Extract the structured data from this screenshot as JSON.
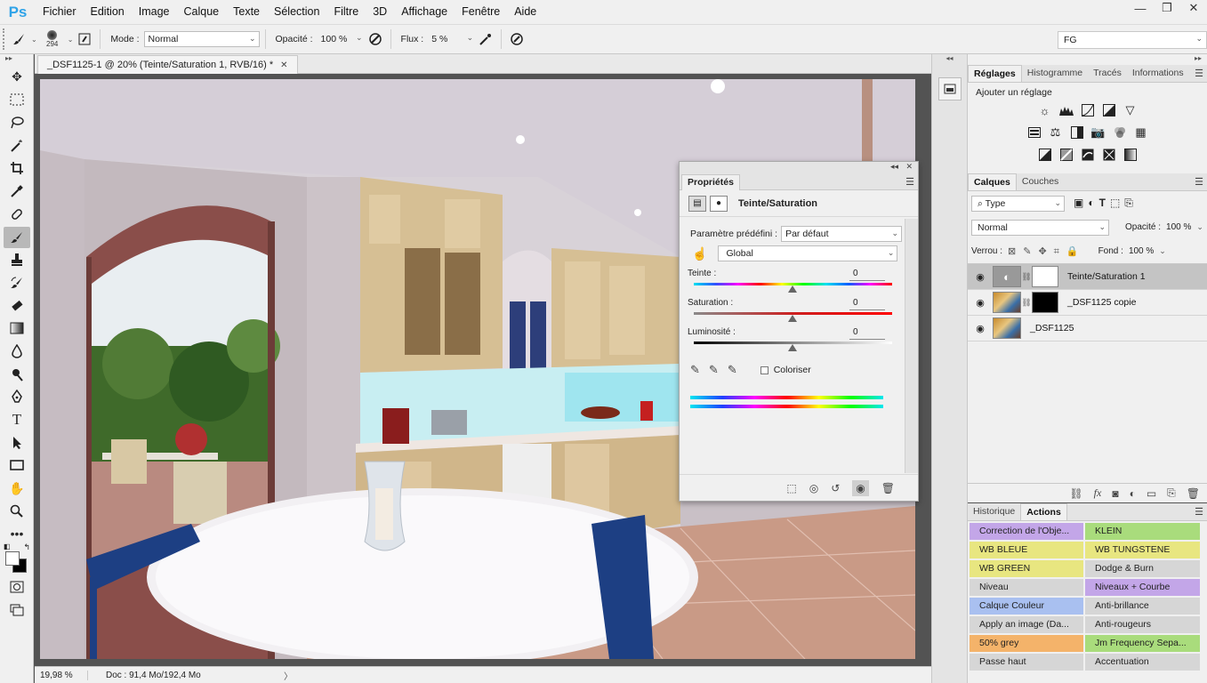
{
  "app": {
    "logo": "Ps"
  },
  "menu": [
    "Fichier",
    "Edition",
    "Image",
    "Calque",
    "Texte",
    "Sélection",
    "Filtre",
    "3D",
    "Affichage",
    "Fenêtre",
    "Aide"
  ],
  "window_controls": {
    "minimize": "—",
    "restore": "❐",
    "close": "✕"
  },
  "options": {
    "brush_size": "294",
    "mode_label": "Mode :",
    "mode_value": "Normal",
    "opacity_label": "Opacité :",
    "opacity_value": "100 %",
    "flow_label": "Flux :",
    "flow_value": "5 %",
    "workspace": "FG"
  },
  "document": {
    "tab_title": "_DSF1125-1 @ 20% (Teinte/Saturation 1, RVB/16) *",
    "zoom": "19,98 %",
    "doc_info": "Doc : 91,4 Mo/192,4 Mo"
  },
  "tools": [
    "move-tool",
    "marquee-tool",
    "lasso-tool",
    "magic-wand-tool",
    "crop-tool",
    "eyedropper-tool",
    "healing-brush-tool",
    "brush-tool",
    "clone-stamp-tool",
    "history-brush-tool",
    "eraser-tool",
    "gradient-tool",
    "blur-tool",
    "dodge-tool",
    "pen-tool",
    "type-tool",
    "path-selection-tool",
    "rectangle-tool",
    "hand-tool",
    "zoom-tool",
    "more-tools"
  ],
  "adjustments_panel": {
    "tabs": [
      "Réglages",
      "Histogramme",
      "Tracés",
      "Informations"
    ],
    "title": "Ajouter un réglage"
  },
  "layers_panel": {
    "tabs": [
      "Calques",
      "Couches"
    ],
    "filter": "Type",
    "blend_mode": "Normal",
    "opacity_label": "Opacité :",
    "opacity_value": "100 %",
    "lock_label": "Verrou :",
    "fill_label": "Fond :",
    "fill_value": "100 %",
    "layers": [
      {
        "name": "Teinte/Saturation 1"
      },
      {
        "name": "_DSF1125 copie"
      },
      {
        "name": "_DSF1125"
      }
    ]
  },
  "actions_panel": {
    "tabs": [
      "Historique",
      "Actions"
    ],
    "items": [
      {
        "label": "Correction de l'Obje...",
        "color": "#c3a6e8"
      },
      {
        "label": "KLEIN",
        "color": "#a9dc7c"
      },
      {
        "label": "WB BLEUE",
        "color": "#e8e680"
      },
      {
        "label": "WB TUNGSTENE",
        "color": "#e8e680"
      },
      {
        "label": "WB GREEN",
        "color": "#e8e680"
      },
      {
        "label": "Dodge & Burn",
        "color": "#d6d6d6"
      },
      {
        "label": "Niveau",
        "color": "#d6d6d6"
      },
      {
        "label": "Niveaux + Courbe",
        "color": "#c3a6e8"
      },
      {
        "label": "Calque Couleur",
        "color": "#a9c0f0"
      },
      {
        "label": "Anti-brillance",
        "color": "#d6d6d6"
      },
      {
        "label": "Apply an image (Da...",
        "color": "#d6d6d6"
      },
      {
        "label": "Anti-rougeurs",
        "color": "#d6d6d6"
      },
      {
        "label": "50% grey",
        "color": "#f4b36a"
      },
      {
        "label": "Jm Frequency Sepa...",
        "color": "#a9dc7c"
      },
      {
        "label": "Passe haut",
        "color": "#d6d6d6"
      },
      {
        "label": "Accentuation",
        "color": "#d6d6d6"
      }
    ]
  },
  "properties_panel": {
    "tab": "Propriétés",
    "title": "Teinte/Saturation",
    "preset_label": "Paramètre prédéfini :",
    "preset_value": "Par défaut",
    "range_value": "Global",
    "hue_label": "Teinte :",
    "hue_value": "0",
    "sat_label": "Saturation :",
    "sat_value": "0",
    "light_label": "Luminosité :",
    "light_value": "0",
    "colorize_label": "Coloriser"
  }
}
